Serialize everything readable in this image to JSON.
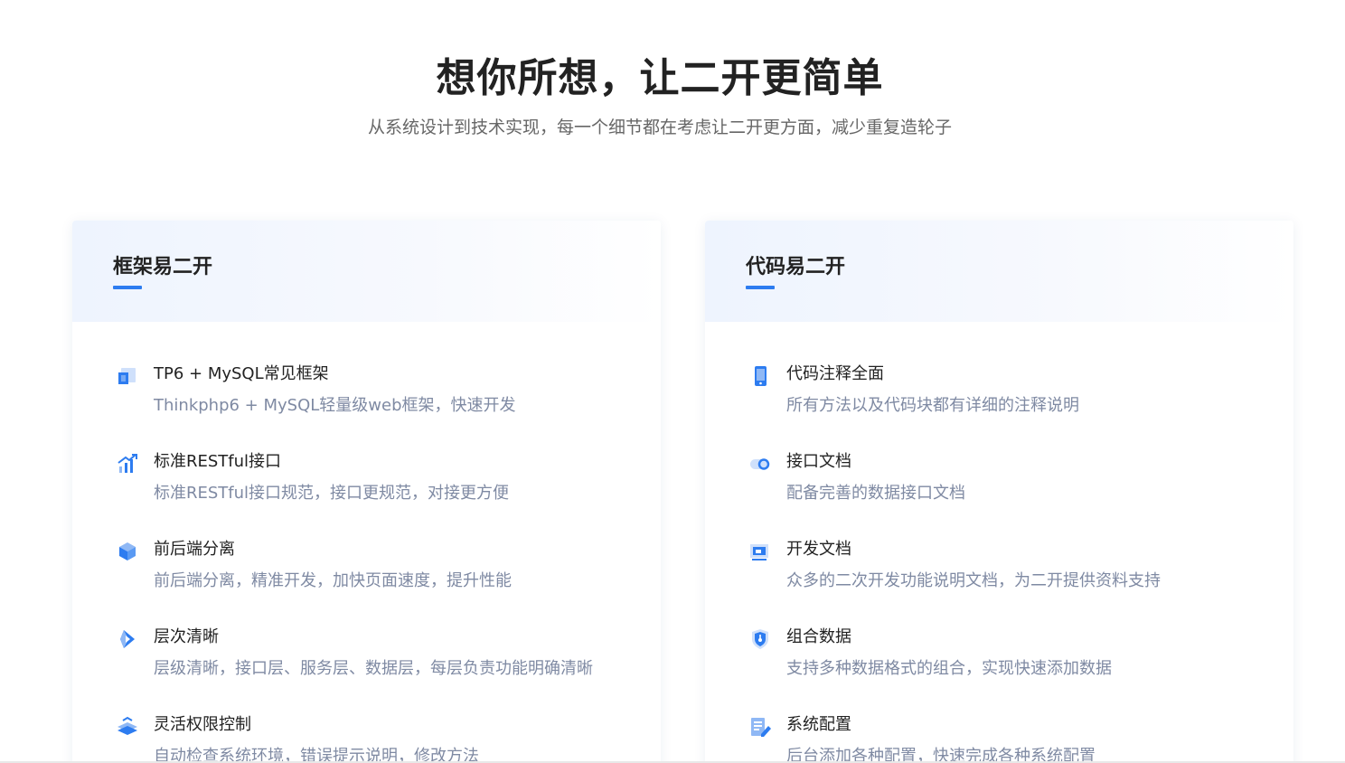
{
  "hero": {
    "title": "想你所想，让二开更简单",
    "subtitle": "从系统设计到技术实现，每一个细节都在考虑让二开更方面，减少重复造轮子"
  },
  "colors": {
    "accent": "#2d7cf0",
    "title": "#222222",
    "description": "#7f8aa3"
  },
  "cards": [
    {
      "title": "框架易二开",
      "features": [
        {
          "icon": "framework-icon",
          "name": "TP6 + MySQL常见框架",
          "desc": "Thinkphp6 + MySQL轻量级web框架，快速开发"
        },
        {
          "icon": "chart-growth-icon",
          "name": "标准RESTful接口",
          "desc": "标准RESTful接口规范，接口更规范，对接更方便"
        },
        {
          "icon": "cube-icon",
          "name": "前后端分离",
          "desc": "前后端分离，精准开发，加快页面速度，提升性能"
        },
        {
          "icon": "layers-arrow-icon",
          "name": "层次清晰",
          "desc": "层级清晰，接口层、服务层、数据层，每层负责功能明确清晰"
        },
        {
          "icon": "permission-stack-icon",
          "name": "灵活权限控制",
          "desc": "自动检查系统环境，错误提示说明，修改方法"
        }
      ]
    },
    {
      "title": "代码易二开",
      "features": [
        {
          "icon": "mobile-icon",
          "name": "代码注释全面",
          "desc": "所有方法以及代码块都有详细的注释说明"
        },
        {
          "icon": "toggle-icon",
          "name": "接口文档",
          "desc": "配备完善的数据接口文档"
        },
        {
          "icon": "monitor-icon",
          "name": "开发文档",
          "desc": "众多的二次开发功能说明文档，为二开提供资料支持"
        },
        {
          "icon": "shield-icon",
          "name": "组合数据",
          "desc": "支持多种数据格式的组合，实现快速添加数据"
        },
        {
          "icon": "edit-document-icon",
          "name": "系统配置",
          "desc": "后台添加各种配置，快速完成各种系统配置"
        }
      ]
    }
  ]
}
